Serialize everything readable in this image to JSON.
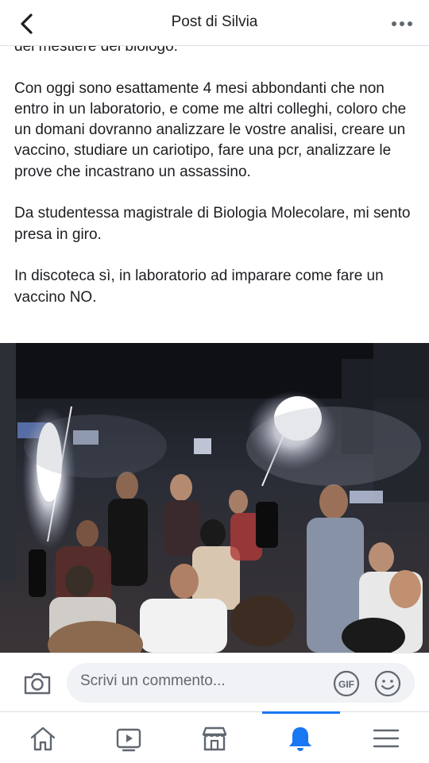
{
  "header": {
    "title": "Post di Silvia"
  },
  "post": {
    "text": "del mestiere del biologo.\n\nCon oggi sono esattamente 4 mesi abbondanti che non entro in un laboratorio, e come me altri colleghi, coloro che un domani dovranno analizzare le vostre analisi, creare un vaccino, studiare un cariotipo, fare una pcr, analizzare le prove che incastrano un assassino.\n\nDa studentessa magistrale di Biologia Molecolare, mi sento presa in giro.\n\nIn discoteca sì, in laboratorio ad imparare come fare un vaccino NO."
  },
  "comment": {
    "placeholder": "Scrivi un commento..."
  },
  "tabs": [
    {
      "icon": "home-icon",
      "active": false
    },
    {
      "icon": "video-icon",
      "active": false
    },
    {
      "icon": "marketplace-icon",
      "active": false
    },
    {
      "icon": "bell-icon",
      "active": true
    },
    {
      "icon": "menu-icon",
      "active": false
    }
  ],
  "colors": {
    "accent": "#1877f2",
    "icon_gray": "#606770",
    "input_bg": "#f0f2f5"
  }
}
